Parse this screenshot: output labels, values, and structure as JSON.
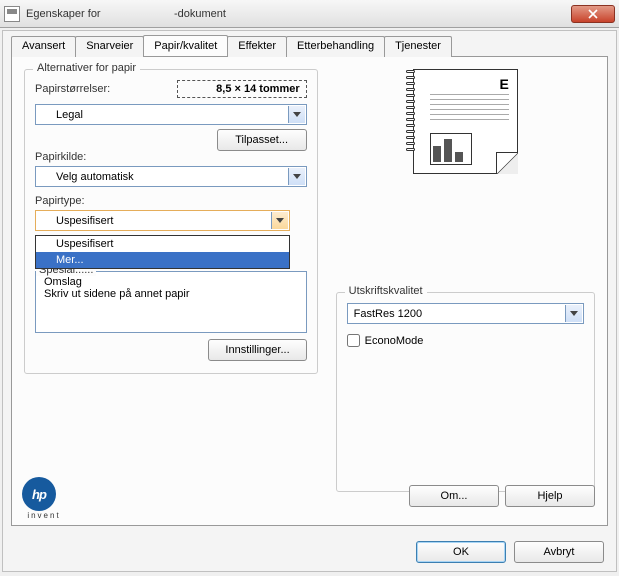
{
  "window": {
    "title_prefix": "Egenskaper for",
    "title_suffix": "-dokument"
  },
  "tabs": {
    "advanced": "Avansert",
    "shortcuts": "Snarveier",
    "paper": "Papir/kvalitet",
    "effects": "Effekter",
    "finishing": "Etterbehandling",
    "services": "Tjenester"
  },
  "paperOptions": {
    "legend": "Alternativer for papir",
    "sizes_label": "Papirstørrelser:",
    "size_value": "8,5 × 14 tommer",
    "size_selected": "Legal",
    "custom_btn": "Tilpasset...",
    "source_label": "Papirkilde:",
    "source_selected": "Velg automatisk",
    "type_label": "Papirtype:",
    "type_selected": "Uspesifisert",
    "type_options": {
      "opt0": "Uspesifisert",
      "opt1": "Mer..."
    },
    "special_cut": "Spesial......",
    "special_items": {
      "i0": "Omslag",
      "i1": "Skriv ut sidene på annet papir"
    },
    "settings_btn": "Innstillinger..."
  },
  "quality": {
    "legend": "Utskriftskvalitet",
    "selected": "FastRes 1200",
    "econo_label": "EconoMode"
  },
  "logo": {
    "brand": "hp",
    "sub": "invent"
  },
  "buttons": {
    "about": "Om...",
    "help": "Hjelp",
    "ok": "OK",
    "cancel": "Avbryt"
  }
}
